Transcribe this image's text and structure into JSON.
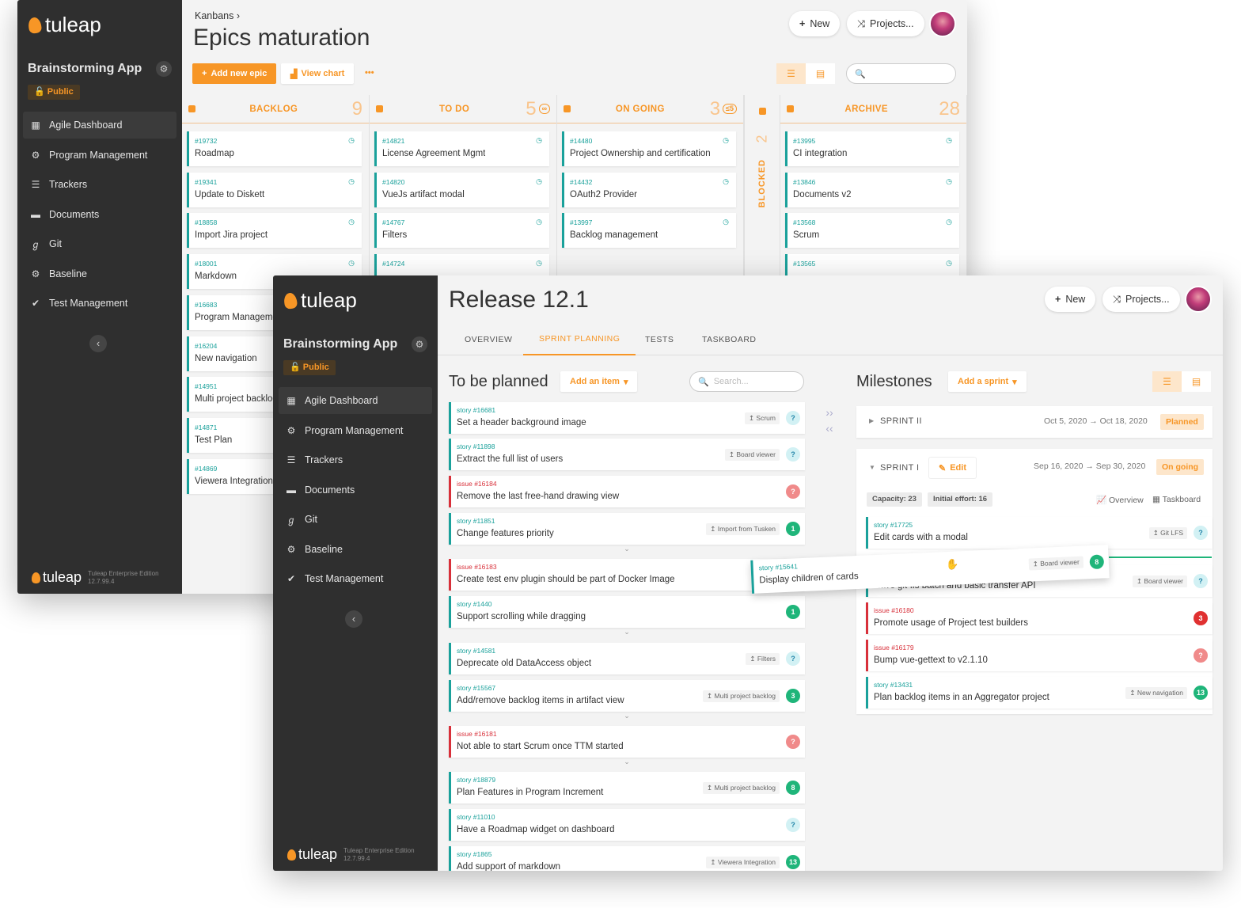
{
  "window1": {
    "logo": "tuleap",
    "project": "Brainstorming App",
    "public_label": "Public",
    "nav": [
      {
        "label": "Agile Dashboard",
        "icon": "table-icon"
      },
      {
        "label": "Program Management",
        "icon": "cogs-icon"
      },
      {
        "label": "Trackers",
        "icon": "list-icon"
      },
      {
        "label": "Documents",
        "icon": "folder-icon"
      },
      {
        "label": "Git",
        "icon": "git-icon"
      },
      {
        "label": "Baseline",
        "icon": "cogs-icon"
      },
      {
        "label": "Test Management",
        "icon": "check-icon"
      }
    ],
    "footer_logo": "tuleap",
    "footer_edition": "Tuleap Enterprise Edition",
    "footer_version": "12.7.99.4",
    "breadcrumb": "Kanbans ›",
    "title": "Epics maturation",
    "new_label": "New",
    "projects_label": "Projects...",
    "add_epic_label": "Add new epic",
    "view_chart_label": "View chart",
    "more_label": "•••",
    "columns": [
      {
        "name": "BACKLOG",
        "count": "9",
        "wip": "",
        "cards": [
          {
            "id": "#19732",
            "title": "Roadmap"
          },
          {
            "id": "#19341",
            "title": "Update to Diskett"
          },
          {
            "id": "#18858",
            "title": "Import Jira project"
          },
          {
            "id": "#18001",
            "title": "Markdown"
          },
          {
            "id": "#16683",
            "title": "Program Management"
          },
          {
            "id": "#16204",
            "title": "New navigation"
          },
          {
            "id": "#14951",
            "title": "Multi project backlog"
          },
          {
            "id": "#14871",
            "title": "Test Plan"
          },
          {
            "id": "#14869",
            "title": "Viewera Integration"
          }
        ]
      },
      {
        "name": "TO DO",
        "count": "5",
        "wip": "∞",
        "cards": [
          {
            "id": "#14821",
            "title": "License Agreement Mgmt"
          },
          {
            "id": "#14820",
            "title": "VueJs artifact modal"
          },
          {
            "id": "#14767",
            "title": "Filters"
          },
          {
            "id": "#14724",
            "title": ""
          }
        ]
      },
      {
        "name": "ON GOING",
        "count": "3",
        "wip": "≤5",
        "cards": [
          {
            "id": "#14480",
            "title": "Project Ownership and certification"
          },
          {
            "id": "#14432",
            "title": "OAuth2 Provider"
          },
          {
            "id": "#13997",
            "title": "Backlog management"
          }
        ]
      },
      {
        "name": "ARCHIVE",
        "count": "28",
        "wip": "",
        "cards": [
          {
            "id": "#13995",
            "title": "CI integration"
          },
          {
            "id": "#13846",
            "title": "Documents v2"
          },
          {
            "id": "#13568",
            "title": "Scrum"
          },
          {
            "id": "#13565",
            "title": ""
          }
        ]
      }
    ],
    "blocked": {
      "name": "BLOCKED",
      "count": "2"
    }
  },
  "window2": {
    "logo": "tuleap",
    "project": "Brainstorming App",
    "public_label": "Public",
    "nav": [
      {
        "label": "Agile Dashboard",
        "icon": "table-icon"
      },
      {
        "label": "Program Management",
        "icon": "cogs-icon"
      },
      {
        "label": "Trackers",
        "icon": "list-icon"
      },
      {
        "label": "Documents",
        "icon": "folder-icon"
      },
      {
        "label": "Git",
        "icon": "git-icon"
      },
      {
        "label": "Baseline",
        "icon": "cogs-icon"
      },
      {
        "label": "Test Management",
        "icon": "check-icon"
      }
    ],
    "footer_logo": "tuleap",
    "footer_edition": "Tuleap Enterprise Edition",
    "footer_version": "12.7.99.4",
    "title": "Release 12.1",
    "new_label": "New",
    "projects_label": "Projects...",
    "tabs": [
      "OVERVIEW",
      "SPRINT PLANNING",
      "TESTS",
      "TASKBOARD"
    ],
    "active_tab": "SPRINT PLANNING",
    "to_be_planned": "To be planned",
    "add_item_label": "Add an item",
    "search_placeholder": "Search...",
    "milestones": "Milestones",
    "add_sprint_label": "Add a sprint",
    "backlog": [
      {
        "id": "story #16681",
        "title": "Set a header background image",
        "parent": "↥ Scrum",
        "count": "?",
        "kind": "story",
        "cnt": "q"
      },
      {
        "id": "story #11898",
        "title": "Extract the full list of users",
        "parent": "↥ Board viewer",
        "count": "?",
        "kind": "story",
        "cnt": "q"
      },
      {
        "id": "issue #16184",
        "title": "Remove the last free-hand drawing view",
        "parent": "",
        "count": "?",
        "kind": "issue",
        "cnt": "r"
      },
      {
        "id": "story #11851",
        "title": "Change features priority",
        "parent": "↥ Import from Tusken",
        "count": "1",
        "kind": "story",
        "cnt": "g"
      },
      {
        "id": "issue #16183",
        "title": "Create test env plugin should be part of Docker Image",
        "parent": "",
        "count": "",
        "kind": "issue",
        "cnt": ""
      },
      {
        "id": "story #1440",
        "title": "Support scrolling while dragging",
        "parent": "",
        "count": "1",
        "kind": "story",
        "cnt": "g"
      },
      {
        "id": "story #14581",
        "title": "Deprecate old DataAccess object",
        "parent": "↥ Filters",
        "count": "?",
        "kind": "story",
        "cnt": "q"
      },
      {
        "id": "story #15567",
        "title": "Add/remove backlog items in artifact view",
        "parent": "↥ Multi project backlog",
        "count": "3",
        "kind": "story",
        "cnt": "g"
      },
      {
        "id": "issue #16181",
        "title": "Not able to start Scrum once TTM started",
        "parent": "",
        "count": "?",
        "kind": "issue",
        "cnt": "r"
      },
      {
        "id": "story #18879",
        "title": "Plan Features in Program Increment",
        "parent": "↥ Multi project backlog",
        "count": "8",
        "kind": "story",
        "cnt": "g"
      },
      {
        "id": "story #11010",
        "title": "Have a Roadmap widget on dashboard",
        "parent": "",
        "count": "?",
        "kind": "story",
        "cnt": "q"
      },
      {
        "id": "story #1865",
        "title": "Add support of markdown",
        "parent": "↥ Viewera Integration",
        "count": "13",
        "kind": "story",
        "cnt": "g"
      }
    ],
    "dragged": {
      "id": "story #15641",
      "title": "Display children of cards",
      "parent": "↥ Board viewer",
      "count": "8"
    },
    "sprint2": {
      "name": "SPRINT II",
      "dates": "Oct 5, 2020 → Oct 18, 2020",
      "status": "Planned"
    },
    "sprint1": {
      "name": "SPRINT I",
      "edit": "Edit",
      "dates": "Sep 16, 2020 → Sep 30, 2020",
      "status": "On going",
      "capacity": "Capacity: 23",
      "effort": "Initial effort: 16",
      "overview": "Overview",
      "taskboard": "Taskboard"
    },
    "sprint_items": [
      {
        "id": "story #17725",
        "title": "Edit cards with a modal",
        "parent": "↥ Git LFS",
        "count": "?",
        "kind": "story",
        "cnt": "q"
      },
      {
        "id": "",
        "title": "Have git-lfs batch and basic transfer API",
        "parent": "↥ Board viewer",
        "count": "?",
        "kind": "story",
        "cnt": "q"
      },
      {
        "id": "issue #16180",
        "title": "Promote usage of Project test builders",
        "parent": "",
        "count": "3",
        "kind": "issue",
        "cnt": "rr"
      },
      {
        "id": "issue #16179",
        "title": "Bump vue-gettext to v2.1.10",
        "parent": "",
        "count": "?",
        "kind": "issue",
        "cnt": "r"
      },
      {
        "id": "story #13431",
        "title": "Plan backlog items in an Aggregator project",
        "parent": "↥ New navigation",
        "count": "13",
        "kind": "story",
        "cnt": "g"
      }
    ],
    "help": "?"
  },
  "colors": {
    "accent": "#f79626",
    "story": "#1aa19b",
    "issue": "#d8303a",
    "sidebar": "#2f2f2f"
  }
}
